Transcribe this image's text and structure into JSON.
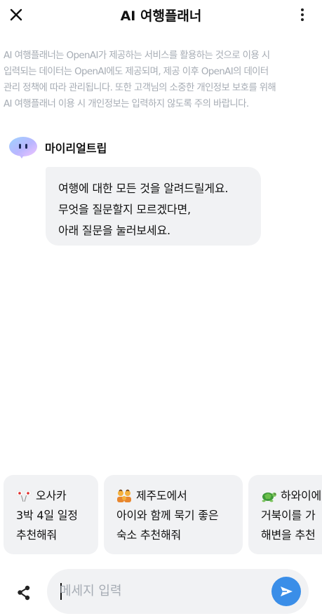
{
  "header": {
    "title": "AI 여행플래너",
    "close_icon": "close-icon",
    "more_icon": "more-vertical-icon"
  },
  "notice": {
    "text": "AI 여행플래너는 OpenAI가 제공하는 서비스를 활용하는 것으로 이용 시\n입력되는 데이터는 OpenAI에도 제공되며, 제공 이후 OpenAI의 데이터\n관리 정책에 따라 관리됩니다. 또한 고객님의 소중한 개인정보 보호를 위해\nAI 여행플래너 이용 시 개인정보는 입력하지 않도록 주의 바랍니다."
  },
  "bot": {
    "name": "마이리얼트립",
    "avatar_icon": "bot-avatar-icon",
    "message_lines": [
      "여행에 대한 모든 것을 알려드릴게요.",
      "무엇을 질문할지 모르겠다면,",
      "아래 질문을 눌러보세요."
    ]
  },
  "suggestions": [
    {
      "emoji_icon": "japan-flags-icon",
      "lines": [
        "오사카",
        "3박 4일 일정",
        "추천해줘"
      ]
    },
    {
      "emoji_icon": "family-icon",
      "lines": [
        "제주도에서",
        "아이와 함께 묵기 좋은",
        "숙소 추천해줘"
      ]
    },
    {
      "emoji_icon": "turtle-icon",
      "lines": [
        "하와이에",
        "거북이를 가",
        "해변을 추천"
      ]
    }
  ],
  "composer": {
    "placeholder": "메세지 입력",
    "value": "",
    "share_icon": "share-icon",
    "send_icon": "send-icon"
  },
  "colors": {
    "notice_text": "#a6acb4",
    "bubble_bg": "#f1f2f4",
    "send_button": "#3a8ee8"
  }
}
